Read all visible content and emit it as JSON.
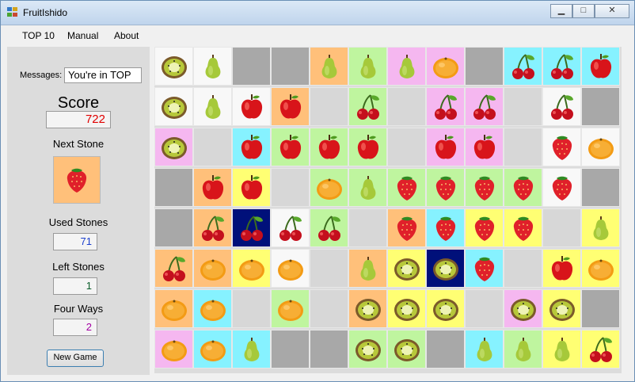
{
  "window": {
    "title": "FruitIshido"
  },
  "menu": [
    "TOP 10",
    "Manual",
    "About"
  ],
  "left_panel": {
    "messages_label": "Messages:",
    "messages_value": "You're in TOP",
    "score_label": "Score",
    "score_value": "722",
    "next_stone_label": "Next Stone",
    "next_stone": {
      "fruit": "strawberry",
      "bg": "#ffc07a"
    },
    "used_label": "Used Stones",
    "used_value": "71",
    "left_label": "Left Stones",
    "left_value": "1",
    "four_label": "Four Ways",
    "four_value": "2",
    "new_game_label": "New Game"
  },
  "colors": {
    "white": "#f8f8f8",
    "empty": "#a8a8a8",
    "light_gray": "#d7d7d7",
    "orange": "#ffc07a",
    "green": "#bff59f",
    "pink": "#f5b7f0",
    "cyan": "#86f2ff",
    "yellow": "#ffff73",
    "navy": "#00107a"
  },
  "board": [
    [
      {
        "fruit": "kiwi",
        "bg": "white"
      },
      {
        "fruit": "pear",
        "bg": "white"
      },
      {
        "fruit": "",
        "bg": "empty"
      },
      {
        "fruit": "",
        "bg": "empty"
      },
      {
        "fruit": "pear",
        "bg": "orange"
      },
      {
        "fruit": "pear",
        "bg": "green"
      },
      {
        "fruit": "pear",
        "bg": "pink"
      },
      {
        "fruit": "orange",
        "bg": "pink"
      },
      {
        "fruit": "",
        "bg": "empty"
      },
      {
        "fruit": "cherry",
        "bg": "cyan"
      },
      {
        "fruit": "cherry",
        "bg": "cyan"
      },
      {
        "fruit": "apple",
        "bg": "cyan"
      }
    ],
    [
      {
        "fruit": "kiwi",
        "bg": "white"
      },
      {
        "fruit": "pear",
        "bg": "white"
      },
      {
        "fruit": "apple",
        "bg": "white"
      },
      {
        "fruit": "apple",
        "bg": "orange"
      },
      {
        "fruit": "",
        "bg": "light_gray"
      },
      {
        "fruit": "cherry",
        "bg": "green"
      },
      {
        "fruit": "",
        "bg": "light_gray"
      },
      {
        "fruit": "cherry",
        "bg": "pink"
      },
      {
        "fruit": "cherry",
        "bg": "pink"
      },
      {
        "fruit": "",
        "bg": "light_gray"
      },
      {
        "fruit": "cherry",
        "bg": "white"
      },
      {
        "fruit": "",
        "bg": "empty"
      }
    ],
    [
      {
        "fruit": "kiwi",
        "bg": "pink"
      },
      {
        "fruit": "",
        "bg": "light_gray"
      },
      {
        "fruit": "apple",
        "bg": "cyan"
      },
      {
        "fruit": "apple",
        "bg": "green"
      },
      {
        "fruit": "apple",
        "bg": "green"
      },
      {
        "fruit": "apple",
        "bg": "green"
      },
      {
        "fruit": "",
        "bg": "light_gray"
      },
      {
        "fruit": "apple",
        "bg": "pink"
      },
      {
        "fruit": "apple",
        "bg": "pink"
      },
      {
        "fruit": "",
        "bg": "light_gray"
      },
      {
        "fruit": "strawberry",
        "bg": "white"
      },
      {
        "fruit": "orange",
        "bg": "white"
      }
    ],
    [
      {
        "fruit": "",
        "bg": "empty"
      },
      {
        "fruit": "apple",
        "bg": "orange"
      },
      {
        "fruit": "apple",
        "bg": "yellow"
      },
      {
        "fruit": "",
        "bg": "light_gray"
      },
      {
        "fruit": "orange",
        "bg": "green"
      },
      {
        "fruit": "pear",
        "bg": "green"
      },
      {
        "fruit": "strawberry",
        "bg": "green"
      },
      {
        "fruit": "strawberry",
        "bg": "green"
      },
      {
        "fruit": "strawberry",
        "bg": "green"
      },
      {
        "fruit": "strawberry",
        "bg": "green"
      },
      {
        "fruit": "strawberry",
        "bg": "white"
      },
      {
        "fruit": "",
        "bg": "empty"
      }
    ],
    [
      {
        "fruit": "",
        "bg": "empty"
      },
      {
        "fruit": "cherry",
        "bg": "orange"
      },
      {
        "fruit": "cherry",
        "bg": "navy"
      },
      {
        "fruit": "cherry",
        "bg": "white"
      },
      {
        "fruit": "cherry",
        "bg": "green"
      },
      {
        "fruit": "",
        "bg": "light_gray"
      },
      {
        "fruit": "strawberry",
        "bg": "orange"
      },
      {
        "fruit": "strawberry",
        "bg": "cyan"
      },
      {
        "fruit": "strawberry",
        "bg": "yellow"
      },
      {
        "fruit": "strawberry",
        "bg": "yellow"
      },
      {
        "fruit": "",
        "bg": "light_gray"
      },
      {
        "fruit": "pear",
        "bg": "yellow"
      }
    ],
    [
      {
        "fruit": "cherry",
        "bg": "orange"
      },
      {
        "fruit": "orange",
        "bg": "orange"
      },
      {
        "fruit": "orange",
        "bg": "yellow"
      },
      {
        "fruit": "orange",
        "bg": "white"
      },
      {
        "fruit": "",
        "bg": "light_gray"
      },
      {
        "fruit": "pear",
        "bg": "orange"
      },
      {
        "fruit": "kiwi",
        "bg": "yellow"
      },
      {
        "fruit": "kiwi",
        "bg": "navy"
      },
      {
        "fruit": "strawberry",
        "bg": "cyan"
      },
      {
        "fruit": "",
        "bg": "light_gray"
      },
      {
        "fruit": "apple",
        "bg": "yellow"
      },
      {
        "fruit": "orange",
        "bg": "yellow"
      }
    ],
    [
      {
        "fruit": "orange",
        "bg": "orange"
      },
      {
        "fruit": "orange",
        "bg": "cyan"
      },
      {
        "fruit": "",
        "bg": "light_gray"
      },
      {
        "fruit": "orange",
        "bg": "green"
      },
      {
        "fruit": "",
        "bg": "light_gray"
      },
      {
        "fruit": "kiwi",
        "bg": "orange"
      },
      {
        "fruit": "kiwi",
        "bg": "yellow"
      },
      {
        "fruit": "kiwi",
        "bg": "yellow"
      },
      {
        "fruit": "",
        "bg": "light_gray"
      },
      {
        "fruit": "kiwi",
        "bg": "pink"
      },
      {
        "fruit": "kiwi",
        "bg": "yellow"
      },
      {
        "fruit": "",
        "bg": "empty"
      }
    ],
    [
      {
        "fruit": "orange",
        "bg": "pink"
      },
      {
        "fruit": "orange",
        "bg": "cyan"
      },
      {
        "fruit": "pear",
        "bg": "cyan"
      },
      {
        "fruit": "",
        "bg": "empty"
      },
      {
        "fruit": "",
        "bg": "empty"
      },
      {
        "fruit": "kiwi",
        "bg": "green"
      },
      {
        "fruit": "kiwi",
        "bg": "green"
      },
      {
        "fruit": "",
        "bg": "empty"
      },
      {
        "fruit": "pear",
        "bg": "cyan"
      },
      {
        "fruit": "pear",
        "bg": "green"
      },
      {
        "fruit": "pear",
        "bg": "yellow"
      },
      {
        "fruit": "cherry",
        "bg": "yellow"
      }
    ]
  ]
}
